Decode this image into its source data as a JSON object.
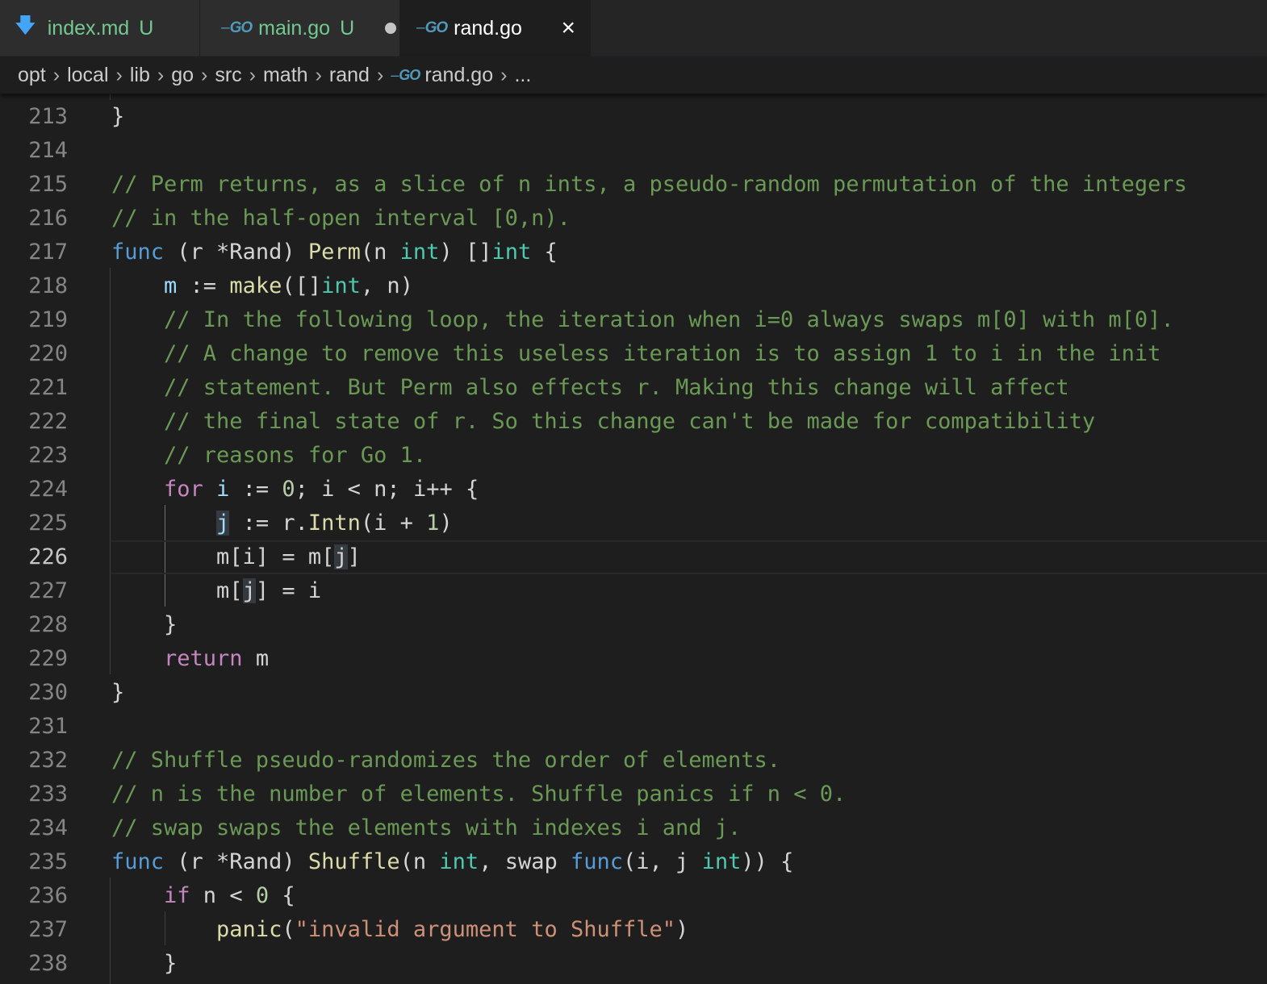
{
  "tabs": [
    {
      "name": "index.md",
      "status": "U"
    },
    {
      "name": "main.go",
      "status": "U"
    },
    {
      "name": "rand.go",
      "close": "×"
    }
  ],
  "breadcrumb": [
    "opt",
    "local",
    "lib",
    "go",
    "src",
    "math",
    "rand",
    "rand.go",
    "..."
  ],
  "icons": {
    "markdown": "markdown-file-icon",
    "go": "go-file-icon",
    "close": "close-icon",
    "dirty": "unsaved-dot-icon"
  },
  "colors": {
    "comment": "#6a9955",
    "keyword": "#569cd6",
    "type": "#4ec9b0",
    "function": "#dcdcaa",
    "control": "#c586c0",
    "string": "#ce9178",
    "number": "#b5cea8",
    "modified": "#73c991"
  },
  "editor": {
    "current_line": 226,
    "lines": [
      {
        "n": 213,
        "tokens": [
          [
            "p",
            "}"
          ]
        ]
      },
      {
        "n": 214,
        "tokens": []
      },
      {
        "n": 215,
        "tokens": [
          [
            "c",
            "// Perm returns, as a slice of n ints, a pseudo-random permutation of the integers"
          ]
        ]
      },
      {
        "n": 216,
        "tokens": [
          [
            "c",
            "// in the half-open interval [0,n)."
          ]
        ]
      },
      {
        "n": 217,
        "tokens": [
          [
            "k",
            "func"
          ],
          [
            "p",
            " (r *Rand) "
          ],
          [
            "f",
            "Perm"
          ],
          [
            "p",
            "(n "
          ],
          [
            "t",
            "int"
          ],
          [
            "p",
            ") []"
          ],
          [
            "t",
            "int"
          ],
          [
            "p",
            " {"
          ]
        ]
      },
      {
        "n": 218,
        "tokens": [
          [
            "p",
            "    "
          ],
          [
            "v",
            "m"
          ],
          [
            "p",
            " := "
          ],
          [
            "f",
            "make"
          ],
          [
            "p",
            "([]"
          ],
          [
            "t",
            "int"
          ],
          [
            "p",
            ", n)"
          ]
        ]
      },
      {
        "n": 219,
        "tokens": [
          [
            "p",
            "    "
          ],
          [
            "c",
            "// In the following loop, the iteration when i=0 always swaps m[0] with m[0]."
          ]
        ]
      },
      {
        "n": 220,
        "tokens": [
          [
            "p",
            "    "
          ],
          [
            "c",
            "// A change to remove this useless iteration is to assign 1 to i in the init"
          ]
        ]
      },
      {
        "n": 221,
        "tokens": [
          [
            "p",
            "    "
          ],
          [
            "c",
            "// statement. But Perm also effects r. Making this change will affect"
          ]
        ]
      },
      {
        "n": 222,
        "tokens": [
          [
            "p",
            "    "
          ],
          [
            "c",
            "// the final state of r. So this change can't be made for compatibility"
          ]
        ]
      },
      {
        "n": 223,
        "tokens": [
          [
            "p",
            "    "
          ],
          [
            "c",
            "// reasons for Go 1."
          ]
        ]
      },
      {
        "n": 224,
        "tokens": [
          [
            "p",
            "    "
          ],
          [
            "kc",
            "for"
          ],
          [
            "p",
            " "
          ],
          [
            "v",
            "i"
          ],
          [
            "p",
            " := "
          ],
          [
            "n",
            "0"
          ],
          [
            "p",
            "; i < n; i++ {"
          ]
        ]
      },
      {
        "n": 225,
        "tokens": [
          [
            "p",
            "        "
          ],
          [
            "vh",
            "j"
          ],
          [
            "p",
            " := r."
          ],
          [
            "f",
            "Intn"
          ],
          [
            "p",
            "(i + "
          ],
          [
            "n",
            "1"
          ],
          [
            "p",
            ")"
          ]
        ]
      },
      {
        "n": 226,
        "tokens": [
          [
            "p",
            "        m[i] = m["
          ],
          [
            "h",
            "j"
          ],
          [
            "p",
            "]"
          ]
        ]
      },
      {
        "n": 227,
        "tokens": [
          [
            "p",
            "        m["
          ],
          [
            "h",
            "j"
          ],
          [
            "p",
            "] = i"
          ]
        ]
      },
      {
        "n": 228,
        "tokens": [
          [
            "p",
            "    }"
          ]
        ]
      },
      {
        "n": 229,
        "tokens": [
          [
            "p",
            "    "
          ],
          [
            "kc",
            "return"
          ],
          [
            "p",
            " m"
          ]
        ]
      },
      {
        "n": 230,
        "tokens": [
          [
            "p",
            "}"
          ]
        ]
      },
      {
        "n": 231,
        "tokens": []
      },
      {
        "n": 232,
        "tokens": [
          [
            "c",
            "// Shuffle pseudo-randomizes the order of elements."
          ]
        ]
      },
      {
        "n": 233,
        "tokens": [
          [
            "c",
            "// n is the number of elements. Shuffle panics if n < 0."
          ]
        ]
      },
      {
        "n": 234,
        "tokens": [
          [
            "c",
            "// swap swaps the elements with indexes i and j."
          ]
        ]
      },
      {
        "n": 235,
        "tokens": [
          [
            "k",
            "func"
          ],
          [
            "p",
            " (r *Rand) "
          ],
          [
            "f",
            "Shuffle"
          ],
          [
            "p",
            "(n "
          ],
          [
            "t",
            "int"
          ],
          [
            "p",
            ", swap "
          ],
          [
            "k",
            "func"
          ],
          [
            "p",
            "(i, j "
          ],
          [
            "t",
            "int"
          ],
          [
            "p",
            ")) {"
          ]
        ]
      },
      {
        "n": 236,
        "tokens": [
          [
            "p",
            "    "
          ],
          [
            "kc",
            "if"
          ],
          [
            "p",
            " n < "
          ],
          [
            "n",
            "0"
          ],
          [
            "p",
            " {"
          ]
        ]
      },
      {
        "n": 237,
        "tokens": [
          [
            "p",
            "        "
          ],
          [
            "f",
            "panic"
          ],
          [
            "p",
            "("
          ],
          [
            "s",
            "\"invalid argument to Shuffle\""
          ],
          [
            "p",
            ")"
          ]
        ]
      },
      {
        "n": 238,
        "tokens": [
          [
            "p",
            "    }"
          ]
        ]
      }
    ]
  }
}
